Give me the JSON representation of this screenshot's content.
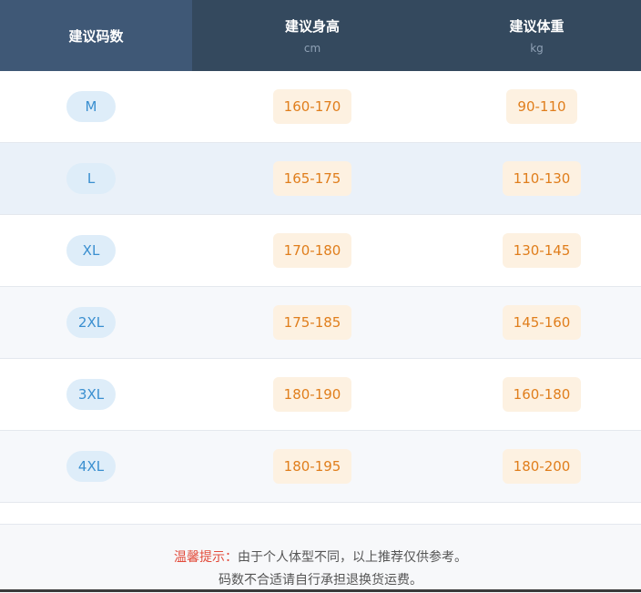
{
  "header": {
    "size_label": "建议码数",
    "height_label": "建议身高",
    "height_unit": "cm",
    "weight_label": "建议体重",
    "weight_unit": "kg"
  },
  "rows": [
    {
      "size": "M",
      "height": "160-170",
      "weight": "90-110"
    },
    {
      "size": "L",
      "height": "165-175",
      "weight": "110-130"
    },
    {
      "size": "XL",
      "height": "170-180",
      "weight": "130-145"
    },
    {
      "size": "2XL",
      "height": "175-185",
      "weight": "145-160"
    },
    {
      "size": "3XL",
      "height": "180-190",
      "weight": "160-180"
    },
    {
      "size": "4XL",
      "height": "180-195",
      "weight": "180-200"
    }
  ],
  "footer": {
    "tip_label": "温馨提示：",
    "tip_line1": "由于个人体型不同，以上推荐仅供参考。",
    "tip_line2": "码数不合适请自行承担退换货运费。"
  },
  "colors": {
    "header_bg": "#34495e",
    "size_pill_bg": "#deedf9",
    "size_text": "#3a8fd0",
    "value_box_bg": "#fdf1e1",
    "value_text": "#e07e1c",
    "tip_label": "#e24b3b"
  }
}
